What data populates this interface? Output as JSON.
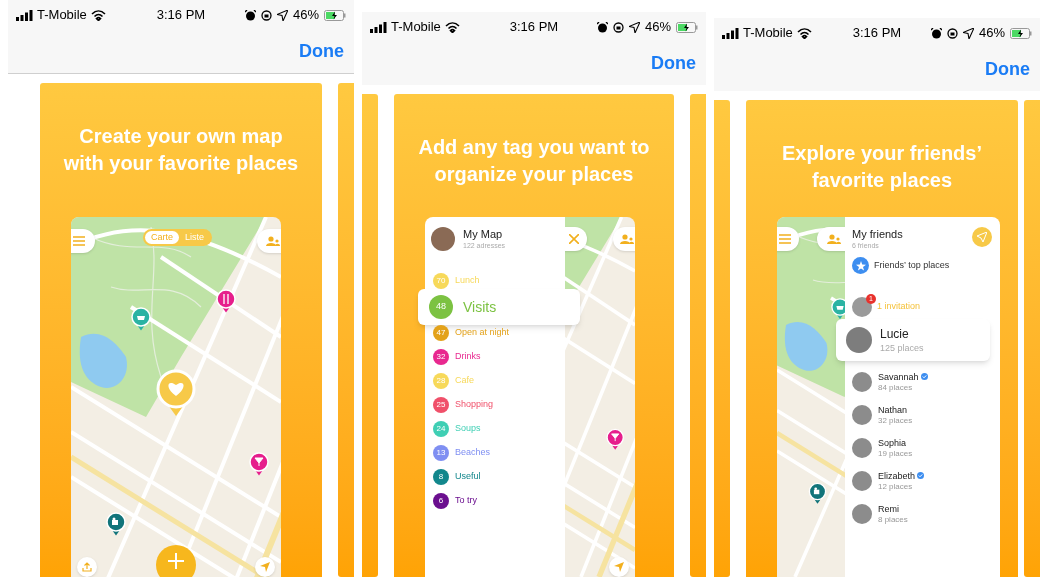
{
  "screens": [
    {
      "status_bar": {
        "carrier": "T-Mobile",
        "time": "3:16 PM",
        "battery": "46%"
      },
      "done": "Done",
      "headline": [
        "Create your own map",
        "with your favorite places"
      ],
      "kind": "map",
      "segments": [
        {
          "label": "Carte",
          "selected": true
        },
        {
          "label": "Liste",
          "selected": false
        }
      ]
    },
    {
      "status_bar": {
        "carrier": "T-Mobile",
        "time": "3:16 PM",
        "battery": "46%"
      },
      "done": "Done",
      "headline": [
        "Add any tag you want to",
        "organize your places"
      ],
      "kind": "tags",
      "title": "My Map",
      "subtitle": "122 adresses",
      "tags": [
        {
          "count": "70",
          "label": "Lunch",
          "color": "#f7d95a",
          "selected": false
        },
        {
          "count": "48",
          "label": "Visits",
          "color": "#7cc242",
          "selected": true
        },
        {
          "count": "47",
          "label": "Open at night",
          "color": "#e3a21a",
          "selected": false
        },
        {
          "count": "32",
          "label": "Drinks",
          "color": "#e8288f",
          "selected": false
        },
        {
          "count": "28",
          "label": "Cafe",
          "color": "#f7d95a",
          "selected": false
        },
        {
          "count": "25",
          "label": "Shopping",
          "color": "#f0506a",
          "selected": false
        },
        {
          "count": "24",
          "label": "Soups",
          "color": "#3fcfb4",
          "selected": false
        },
        {
          "count": "13",
          "label": "Beaches",
          "color": "#7f8ff2",
          "selected": false
        },
        {
          "count": "8",
          "label": "Useful",
          "color": "#12878c",
          "selected": false
        },
        {
          "count": "6",
          "label": "To try",
          "color": "#6b0f8f",
          "selected": false
        }
      ]
    },
    {
      "status_bar": {
        "carrier": "T-Mobile",
        "time": "3:16 PM",
        "battery": "46%"
      },
      "done": "Done",
      "headline": [
        "Explore your friends’",
        "favorite places"
      ],
      "kind": "friends",
      "title": "My friends",
      "subtitle": "6 friends",
      "top_places": "Friends’ top places",
      "invitation": {
        "badge": "1",
        "label": "1 invitation"
      },
      "friends": [
        {
          "name": "Lucie",
          "places": "125 places",
          "verified": false,
          "selected": true
        },
        {
          "name": "Savannah",
          "places": "84 places",
          "verified": true,
          "selected": false
        },
        {
          "name": "Nathan",
          "places": "32 places",
          "verified": false,
          "selected": false
        },
        {
          "name": "Sophia",
          "places": "19 places",
          "verified": false,
          "selected": false
        },
        {
          "name": "Elizabeth",
          "places": "12 places",
          "verified": true,
          "selected": false
        },
        {
          "name": "Remi",
          "places": "8 places",
          "verified": false,
          "selected": false
        }
      ]
    }
  ]
}
